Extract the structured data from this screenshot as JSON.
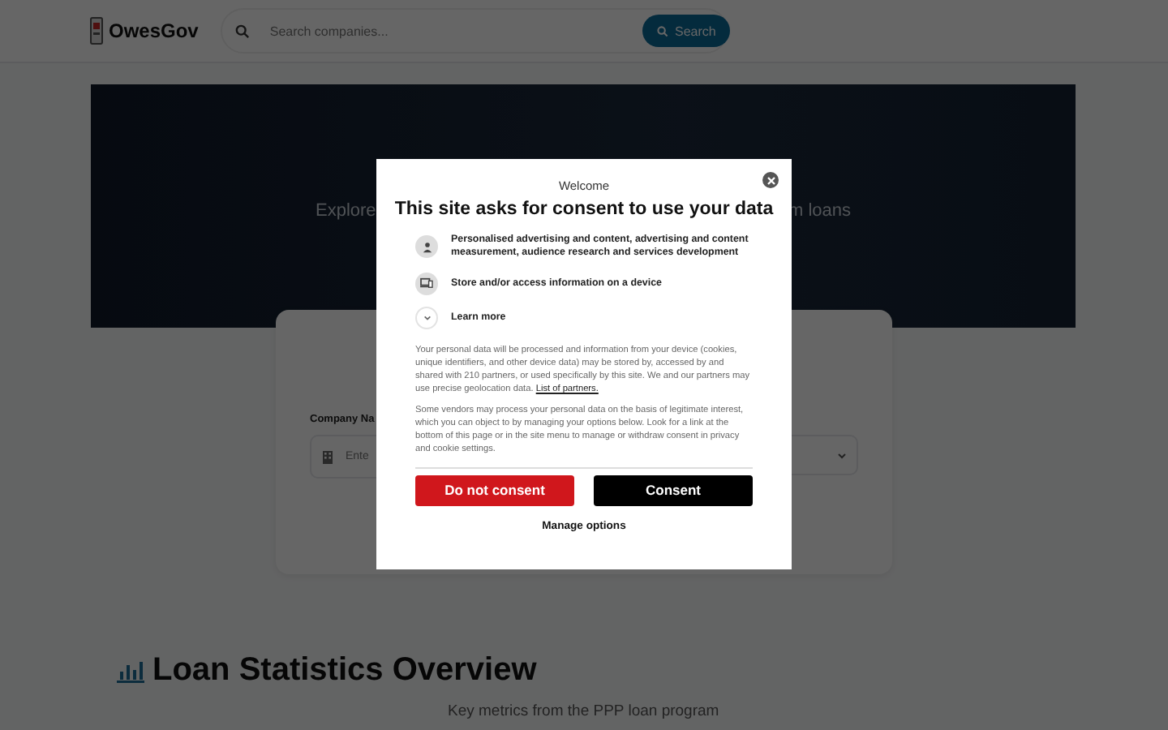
{
  "header": {
    "brand": "OwesGov",
    "search": {
      "placeholder": "Search companies..."
    },
    "search_button": "Search"
  },
  "hero": {
    "subtitle_left": "Explore",
    "subtitle_right": "m loans"
  },
  "search_card": {
    "field_label": "Company Na",
    "field_placeholder": "Ente"
  },
  "section": {
    "title": "Loan Statistics Overview",
    "subtitle": "Key metrics from the PPP loan program"
  },
  "consent_dialog": {
    "eyebrow": "Welcome",
    "title": "This site asks for consent to use your data",
    "purposes": [
      {
        "kind": "person",
        "text": "Personalised advertising and content, advertising and content measurement, audience research and services development"
      },
      {
        "kind": "device",
        "text": "Store and/or access information on a device"
      },
      {
        "kind": "expand",
        "text": "Learn more"
      }
    ],
    "paragraph_1": "Your personal data will be processed and information from your device (cookies, unique identifiers, and other device data) may be stored by, accessed by and shared with 210 partners, or used specifically by this site. We and our partners may use precise geolocation data.",
    "partners_link": "List of partners.",
    "paragraph_2": "Some vendors may process your personal data on the basis of legitimate interest, which you can object to by managing your options below. Look for a link at the bottom of this page or in the site menu to manage or withdraw consent in privacy and cookie settings.",
    "buttons": [
      {
        "kind": "reject",
        "label": "Do not consent"
      },
      {
        "kind": "accept",
        "label": "Consent"
      }
    ],
    "manage": "Manage options"
  }
}
